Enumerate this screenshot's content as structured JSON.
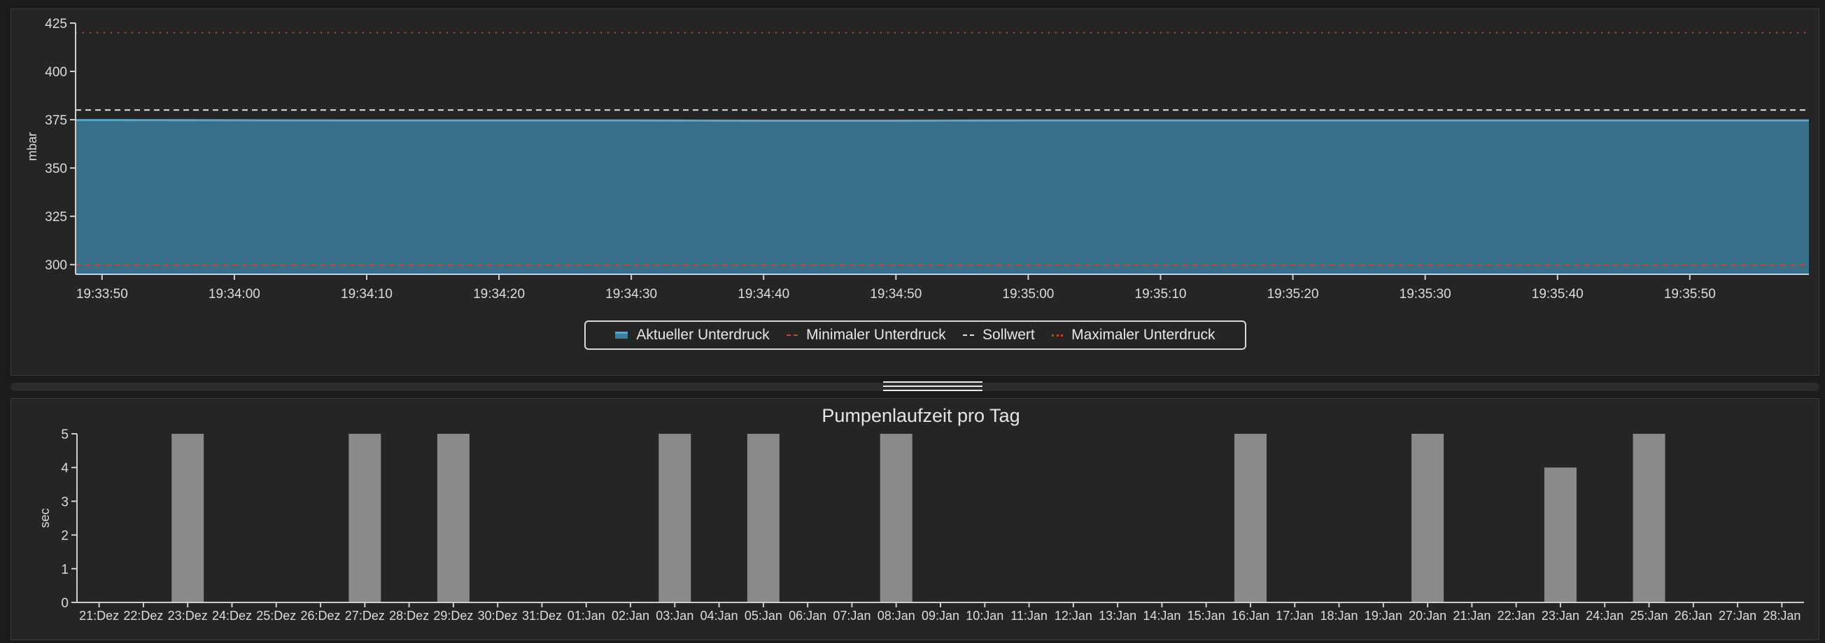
{
  "chart_data": [
    {
      "type": "area",
      "title": "",
      "xlabel": "",
      "ylabel": "mbar",
      "ylim": [
        295,
        425
      ],
      "yticks": [
        300,
        325,
        350,
        375,
        400,
        425
      ],
      "x_ticks": [
        "19:33:50",
        "19:34:00",
        "19:34:10",
        "19:34:20",
        "19:34:30",
        "19:34:40",
        "19:34:50",
        "19:35:00",
        "19:35:10",
        "19:35:20",
        "19:35:30",
        "19:35:40",
        "19:35:50"
      ],
      "x": [
        "19:33:48",
        "19:33:50",
        "19:34:00",
        "19:34:10",
        "19:34:20",
        "19:34:30",
        "19:34:40",
        "19:34:50",
        "19:35:00",
        "19:35:10",
        "19:35:20",
        "19:35:30",
        "19:35:40",
        "19:35:50",
        "19:35:59"
      ],
      "series": [
        {
          "name": "Aktueller Unterdruck",
          "kind": "area",
          "color": "#3a6f89",
          "line_color": "#5aa5d0",
          "values": [
            374.8,
            374.8,
            374.7,
            374.6,
            374.6,
            374.6,
            374.5,
            374.5,
            374.6,
            374.6,
            374.6,
            374.6,
            374.6,
            374.6,
            374.6
          ]
        },
        {
          "name": "Minimaler Unterdruck",
          "kind": "dashed",
          "color": "#c8452f",
          "value": 300
        },
        {
          "name": "Sollwert",
          "kind": "dashed",
          "color": "#e0e0e0",
          "value": 380
        },
        {
          "name": "Maximaler Unterdruck",
          "kind": "dotted",
          "color": "#c8452f",
          "value": 420
        }
      ],
      "legend": "bottom-center",
      "grid": false
    },
    {
      "type": "bar",
      "title": "Pumpenlaufzeit pro Tag",
      "xlabel": "",
      "ylabel": "sec",
      "ylim": [
        0,
        5
      ],
      "yticks": [
        0,
        1,
        2,
        3,
        4,
        5
      ],
      "bar_color": "#8a8a8a",
      "categories": [
        "21:Dez",
        "22:Dez",
        "23:Dez",
        "24:Dez",
        "25:Dez",
        "26:Dez",
        "27:Dez",
        "28:Dez",
        "29:Dez",
        "30:Dez",
        "31:Dez",
        "01:Jan",
        "02:Jan",
        "03:Jan",
        "04:Jan",
        "05:Jan",
        "06:Jan",
        "07:Jan",
        "08:Jan",
        "09:Jan",
        "10:Jan",
        "11:Jan",
        "12:Jan",
        "13:Jan",
        "14:Jan",
        "15:Jan",
        "16:Jan",
        "17:Jan",
        "18:Jan",
        "19:Jan",
        "20:Jan",
        "21:Jan",
        "22:Jan",
        "23:Jan",
        "24:Jan",
        "25:Jan",
        "26:Jan",
        "27:Jan",
        "28:Jan"
      ],
      "values": [
        0,
        0,
        5,
        0,
        0,
        0,
        5,
        0,
        5,
        0,
        0,
        0,
        0,
        5,
        0,
        5,
        0,
        0,
        5,
        0,
        0,
        0,
        0,
        0,
        0,
        0,
        5,
        0,
        0,
        0,
        5,
        0,
        0,
        4,
        0,
        5,
        0,
        0,
        0
      ],
      "grid": false
    }
  ]
}
